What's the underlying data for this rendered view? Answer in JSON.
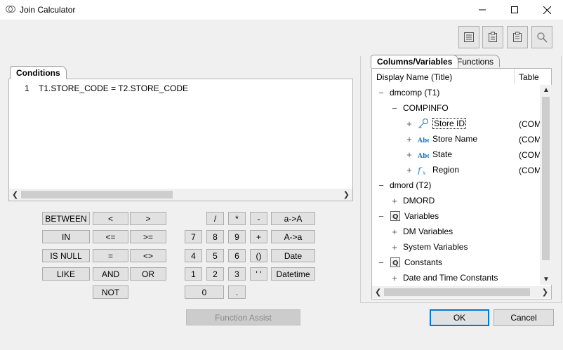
{
  "window": {
    "title": "Join Calculator"
  },
  "toolbar": {
    "icons": [
      "list-icon",
      "paste-icon",
      "clipboard-icon",
      "search-icon"
    ]
  },
  "conditions": {
    "tab_label": "Conditions",
    "line_number": "1",
    "expression": "T1.STORE_CODE = T2.STORE_CODE"
  },
  "keypad": {
    "between": "BETWEEN",
    "lt": "<",
    "gt": ">",
    "in": "IN",
    "le": "<=",
    "ge": ">=",
    "isnull": "IS NULL",
    "eq": "=",
    "ne": "<>",
    "like": "LIKE",
    "and": "AND",
    "or": "OR",
    "not": "NOT",
    "div": "/",
    "mul": "*",
    "minus": "-",
    "upper": "a->A",
    "n7": "7",
    "n8": "8",
    "n9": "9",
    "plus": "+",
    "lower": "A->a",
    "n4": "4",
    "n5": "5",
    "n6": "6",
    "parens": "()",
    "date": "Date",
    "n1": "1",
    "n2": "2",
    "n3": "3",
    "quotes": "' '",
    "datetime": "Datetime",
    "n0": "0",
    "dot": ".",
    "function_assist": "Function Assist"
  },
  "panel": {
    "tabs": [
      "Columns/Variables",
      "Functions"
    ],
    "columns": [
      "Display Name (Title)",
      "Table"
    ],
    "rows": {
      "dmcomp": "dmcomp (T1)",
      "compinfo": "COMPINFO",
      "store_id": "Store ID",
      "store_name": "Store Name",
      "state": "State",
      "region": "Region",
      "dmord": "dmord (T2)",
      "dmord_seg": "DMORD",
      "variables": "Variables",
      "dm_variables": "DM Variables",
      "system_variables": "System Variables",
      "constants": "Constants",
      "date_time_constants": "Date and Time Constants"
    },
    "table_values": [
      "(COM",
      "(COM",
      "(COM",
      "(COM"
    ]
  },
  "buttons": {
    "ok": "OK",
    "cancel": "Cancel"
  },
  "colors": {
    "accent": "#0078d7",
    "abc_icon": "#1e78c8"
  }
}
